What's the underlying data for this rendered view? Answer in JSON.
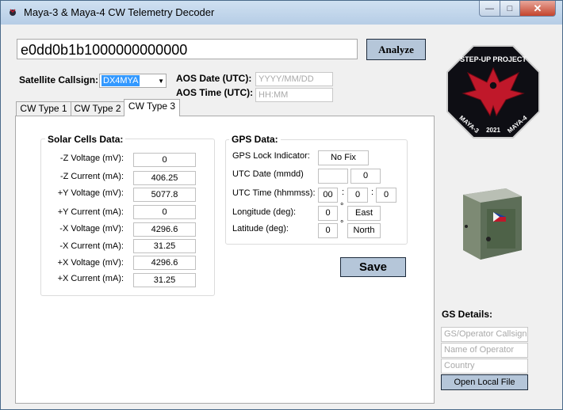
{
  "window": {
    "title": "Maya-3 & Maya-4 CW Telemetry Decoder",
    "controls": {
      "minimize": "—",
      "maximize": "□",
      "close": "✕"
    }
  },
  "decoder": {
    "hex_input_value": "e0dd0b1b1000000000000",
    "analyze_label": "Analyze",
    "callsign_label": "Satellite Callsign:",
    "callsign_value": "DX4MYA",
    "aos_date_label": "AOS Date (UTC):",
    "aos_date_placeholder": "YYYY/MM/DD",
    "aos_time_label": "AOS Time (UTC):",
    "aos_time_placeholder": "HH:MM"
  },
  "tabs": [
    "CW Type 1",
    "CW Type 2",
    "CW Type 3"
  ],
  "active_tab": "CW Type 3",
  "solar": {
    "title": "Solar Cells Data:",
    "rows": [
      {
        "label": "-Z Voltage (mV):",
        "value": "0"
      },
      {
        "label": "-Z Current (mA):",
        "value": "406.25"
      },
      {
        "label": "+Y Voltage (mV):",
        "value": "5077.8"
      },
      {
        "label": "+Y Current (mA):",
        "value": "0"
      },
      {
        "label": "-X Voltage (mV):",
        "value": "4296.6"
      },
      {
        "label": "-X Current (mA):",
        "value": "31.25"
      },
      {
        "label": "+X Voltage (mV):",
        "value": "4296.6"
      },
      {
        "label": "+X Current (mA):",
        "value": "31.25"
      }
    ]
  },
  "gps": {
    "title": "GPS Data:",
    "lock_label": "GPS Lock Indicator:",
    "lock_value": "No Fix",
    "date_label": "UTC Date (mmdd)",
    "date_month": "",
    "date_day": "0",
    "time_label": "UTC Time (hhmmss):",
    "time_hh": "00",
    "time_mm": "0",
    "time_ss": "0",
    "time_sep": ":",
    "lon_label": "Longitude (deg):",
    "lon_value": "0",
    "lon_dir": "East",
    "lat_label": "Latitude (deg):",
    "lat_value": "0",
    "lat_dir": "North",
    "degree_symbol": "°"
  },
  "save_label": "Save",
  "gs": {
    "title": "GS Details:",
    "callsign_placeholder": "GS/Operator Callsign",
    "name_placeholder": "Name of Operator",
    "country_placeholder": "Country",
    "open_file_label": "Open Local File"
  },
  "logo": {
    "top_text": "STEP-UP PROJECT",
    "bottom_left": "MAYA-3",
    "bottom_center": "2021",
    "bottom_right": "MAYA-4"
  },
  "colors": {
    "button_bg": "#b5c6d9",
    "selection": "#3399ff",
    "logo_bg": "#0e0e14",
    "logo_red": "#c0182a"
  },
  "icons": {
    "app": "app-icon",
    "combo_arrow": "chevron-down-icon"
  }
}
